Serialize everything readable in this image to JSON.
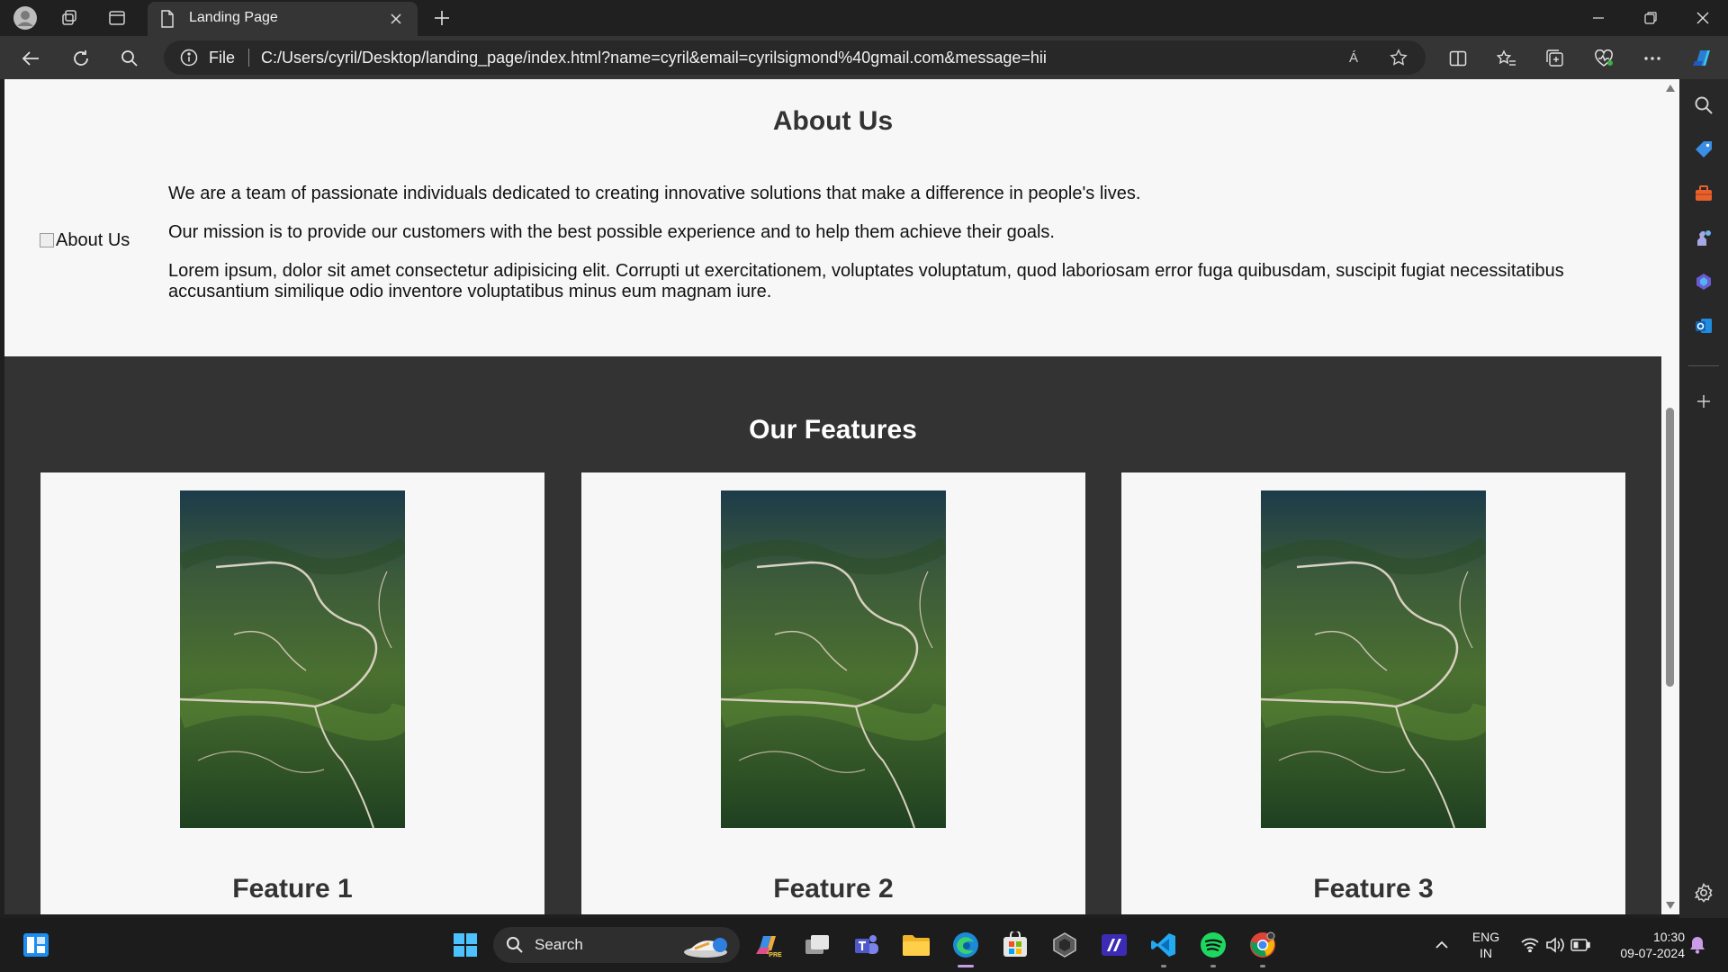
{
  "browser": {
    "tab_title": "Landing Page",
    "address_scheme": "File",
    "address_url": "C:/Users/cyril/Desktop/landing_page/index.html?name=cyril&email=cyrilsigmond%40gmail.com&message=hii",
    "read_aloud_label": "Á"
  },
  "about": {
    "heading": "About Us",
    "image_alt": "About Us",
    "paragraphs": [
      "We are a team of passionate individuals dedicated to creating innovative solutions that make a difference in people's lives.",
      "Our mission is to provide our customers with the best possible experience and to help them achieve their goals.",
      "Lorem ipsum, dolor sit amet consectetur adipisicing elit. Corrupti ut exercitationem, voluptates voluptatum, quod laboriosam error fuga quibusdam, suscipit fugiat necessitatibus accusantium similique odio inventore voluptatibus minus eum magnam iure."
    ]
  },
  "features": {
    "heading": "Our Features",
    "cards": [
      {
        "title": "Feature 1"
      },
      {
        "title": "Feature 2"
      },
      {
        "title": "Feature 3"
      }
    ]
  },
  "taskbar": {
    "search_label": "Search",
    "lang_line1": "ENG",
    "lang_line2": "IN",
    "time": "10:30",
    "date": "09-07-2024"
  },
  "colors": {
    "about_bg": "#f7f7f7",
    "features_bg": "#333333",
    "card_bg": "#f7f7f7",
    "heading_text": "#333333"
  }
}
